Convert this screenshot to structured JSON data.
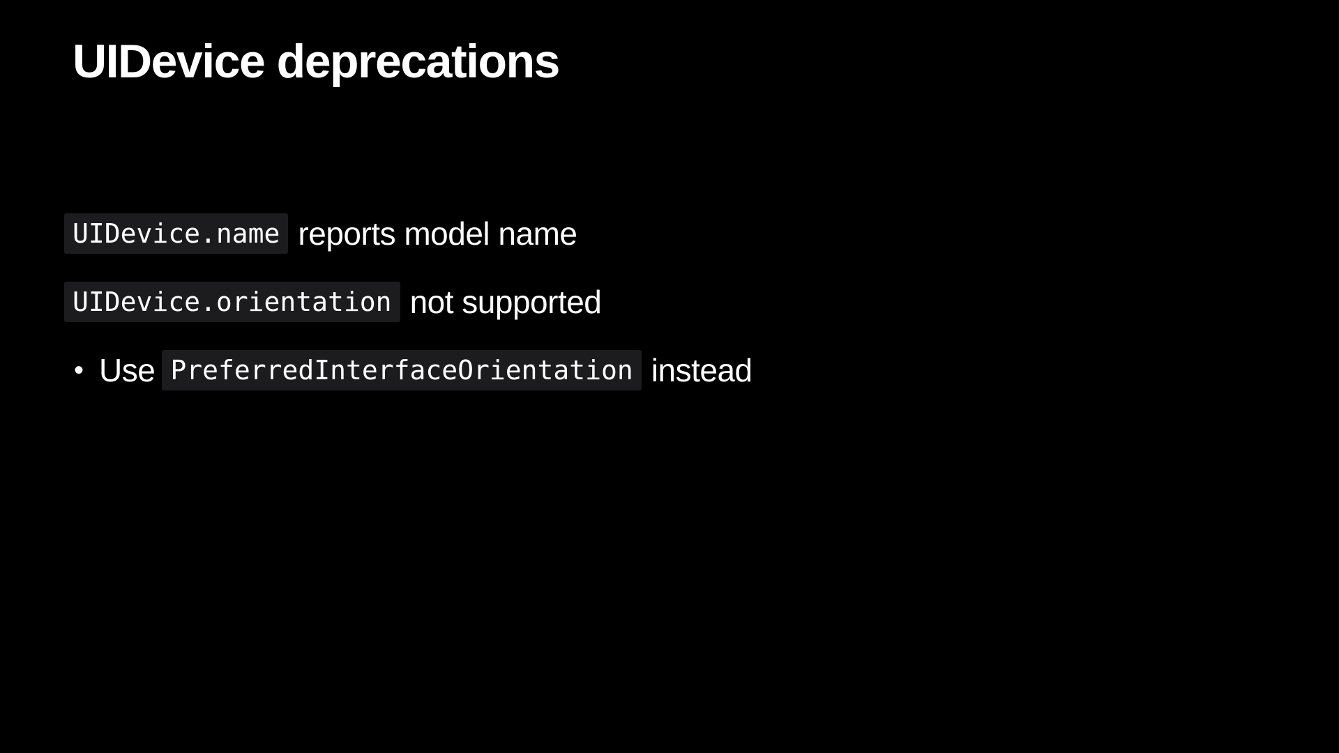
{
  "slide": {
    "title": "UIDevice deprecations",
    "items": [
      {
        "code": "UIDevice.name",
        "text": "reports model name"
      },
      {
        "code": "UIDevice.orientation",
        "text": "not supported"
      }
    ],
    "subitem": {
      "bullet": "•",
      "prefix": "Use",
      "code": "PreferredInterfaceOrientation",
      "suffix": "instead"
    }
  },
  "colors": {
    "background": "#000000",
    "text": "#ffffff",
    "code_background": "#1c1c1e"
  }
}
